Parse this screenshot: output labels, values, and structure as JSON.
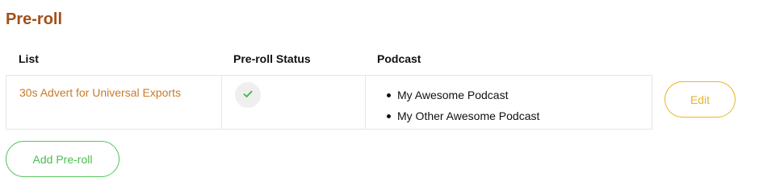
{
  "page": {
    "title": "Pre-roll"
  },
  "table": {
    "headers": [
      "List",
      "Pre-roll Status",
      "Podcast"
    ],
    "rows": [
      {
        "list": "30s Advert for Universal Exports",
        "status_icon": "checkmark-icon",
        "podcasts": [
          "My Awesome Podcast",
          "My Other Awesome Podcast"
        ],
        "edit_label": "Edit"
      }
    ]
  },
  "actions": {
    "add_label": "Add Pre-roll"
  },
  "colors": {
    "title": "#a24f19",
    "link": "#c97a2a",
    "edit_accent": "#e8b52a",
    "add_accent": "#56c65d",
    "check": "#4cbd52"
  }
}
